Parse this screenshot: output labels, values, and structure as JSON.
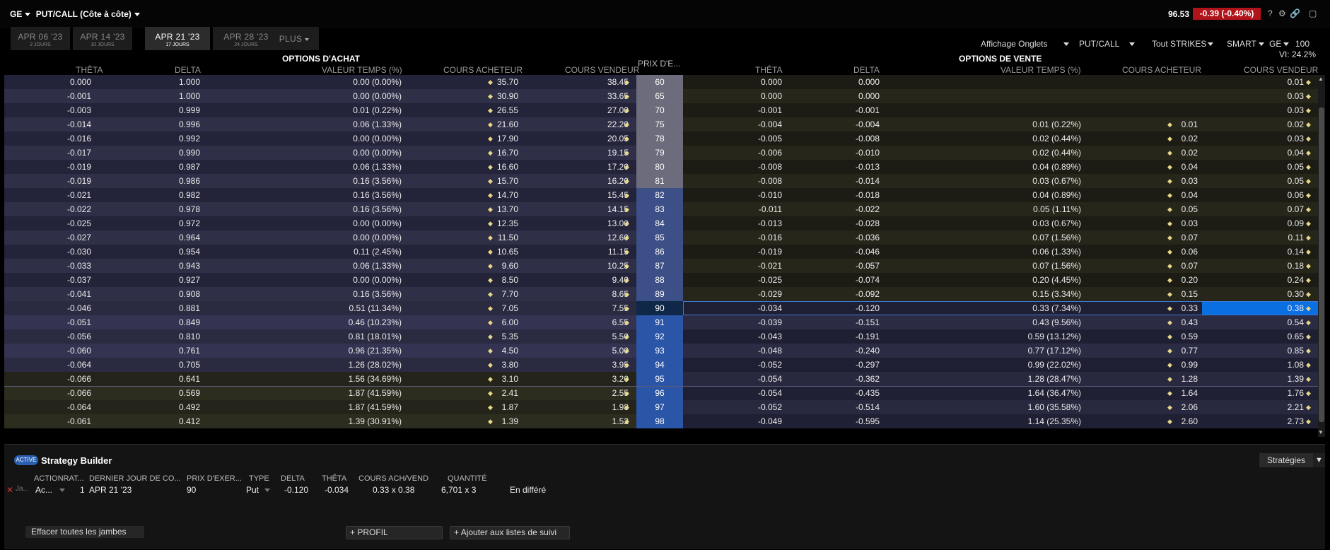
{
  "topbar": {
    "symbol": "GE",
    "view": "PUT/CALL (Côte à côte)",
    "last_price": "96.53",
    "change": "-0.39 (-0.40%)",
    "icons": [
      "help-icon",
      "gear-icon",
      "link-icon",
      "expand-icon"
    ]
  },
  "tabs": [
    {
      "label": "APR 06 '23",
      "sub": "2 JOURS"
    },
    {
      "label": "APR 14 '23",
      "sub": "10 JOURS"
    },
    {
      "label": "APR 21 '23",
      "sub": "17 JOURS"
    },
    {
      "label": "APR 28 '23",
      "sub": "24 JOURS"
    },
    {
      "label": "PLUS",
      "sub": ""
    }
  ],
  "toolbar": {
    "display": "Affichage Onglets",
    "putcall": "PUT/CALL",
    "strikes": "Tout STRIKES",
    "exchange": "SMART",
    "symbol": "GE",
    "multiplier": "100",
    "vi": "VI: 24.2%"
  },
  "headers": {
    "calls_title": "OPTIONS D'ACHAT",
    "puts_title": "OPTIONS DE VENTE",
    "theta": "THÊTA",
    "delta": "DELTA",
    "time_value": "VALEUR TEMPS (%)",
    "bid": "COURS ACHETEUR",
    "ask": "COURS VENDEUR",
    "strike": "PRIX D'E..."
  },
  "rows": [
    {
      "strike": "60",
      "c_theta": "0.000",
      "c_delta": "1.000",
      "c_tv": "0.00 (0.00%)",
      "c_bid": "35.70",
      "c_ask": "38.45",
      "p_theta": "0.000",
      "p_delta": "0.000",
      "p_tv": "",
      "p_bid": "",
      "p_ask": "0.01"
    },
    {
      "strike": "65",
      "c_theta": "-0.001",
      "c_delta": "1.000",
      "c_tv": "0.00 (0.00%)",
      "c_bid": "30.90",
      "c_ask": "33.65",
      "p_theta": "0.000",
      "p_delta": "0.000",
      "p_tv": "",
      "p_bid": "",
      "p_ask": "0.03"
    },
    {
      "strike": "70",
      "c_theta": "-0.003",
      "c_delta": "0.999",
      "c_tv": "0.01 (0.22%)",
      "c_bid": "26.55",
      "c_ask": "27.00",
      "p_theta": "-0.001",
      "p_delta": "-0.001",
      "p_tv": "",
      "p_bid": "",
      "p_ask": "0.03"
    },
    {
      "strike": "75",
      "c_theta": "-0.014",
      "c_delta": "0.996",
      "c_tv": "0.06 (1.33%)",
      "c_bid": "21.60",
      "c_ask": "22.20",
      "p_theta": "-0.004",
      "p_delta": "-0.004",
      "p_tv": "0.01 (0.22%)",
      "p_bid": "0.01",
      "p_ask": "0.02"
    },
    {
      "strike": "78",
      "c_theta": "-0.016",
      "c_delta": "0.992",
      "c_tv": "0.00 (0.00%)",
      "c_bid": "17.90",
      "c_ask": "20.05",
      "p_theta": "-0.005",
      "p_delta": "-0.008",
      "p_tv": "0.02 (0.44%)",
      "p_bid": "0.02",
      "p_ask": "0.03"
    },
    {
      "strike": "79",
      "c_theta": "-0.017",
      "c_delta": "0.990",
      "c_tv": "0.00 (0.00%)",
      "c_bid": "16.70",
      "c_ask": "19.15",
      "p_theta": "-0.006",
      "p_delta": "-0.010",
      "p_tv": "0.02 (0.44%)",
      "p_bid": "0.02",
      "p_ask": "0.04"
    },
    {
      "strike": "80",
      "c_theta": "-0.019",
      "c_delta": "0.987",
      "c_tv": "0.06 (1.33%)",
      "c_bid": "16.60",
      "c_ask": "17.20",
      "p_theta": "-0.008",
      "p_delta": "-0.013",
      "p_tv": "0.04 (0.89%)",
      "p_bid": "0.04",
      "p_ask": "0.05"
    },
    {
      "strike": "81",
      "c_theta": "-0.019",
      "c_delta": "0.986",
      "c_tv": "0.16 (3.56%)",
      "c_bid": "15.70",
      "c_ask": "16.20",
      "p_theta": "-0.008",
      "p_delta": "-0.014",
      "p_tv": "0.03 (0.67%)",
      "p_bid": "0.03",
      "p_ask": "0.05"
    },
    {
      "strike": "82",
      "c_theta": "-0.021",
      "c_delta": "0.982",
      "c_tv": "0.16 (3.56%)",
      "c_bid": "14.70",
      "c_ask": "15.45",
      "p_theta": "-0.010",
      "p_delta": "-0.018",
      "p_tv": "0.04 (0.89%)",
      "p_bid": "0.04",
      "p_ask": "0.06"
    },
    {
      "strike": "83",
      "c_theta": "-0.022",
      "c_delta": "0.978",
      "c_tv": "0.16 (3.56%)",
      "c_bid": "13.70",
      "c_ask": "14.15",
      "p_theta": "-0.011",
      "p_delta": "-0.022",
      "p_tv": "0.05 (1.11%)",
      "p_bid": "0.05",
      "p_ask": "0.07"
    },
    {
      "strike": "84",
      "c_theta": "-0.025",
      "c_delta": "0.972",
      "c_tv": "0.00 (0.00%)",
      "c_bid": "12.35",
      "c_ask": "13.00",
      "p_theta": "-0.013",
      "p_delta": "-0.028",
      "p_tv": "0.03 (0.67%)",
      "p_bid": "0.03",
      "p_ask": "0.09"
    },
    {
      "strike": "85",
      "c_theta": "-0.027",
      "c_delta": "0.964",
      "c_tv": "0.00 (0.00%)",
      "c_bid": "11.50",
      "c_ask": "12.60",
      "p_theta": "-0.016",
      "p_delta": "-0.036",
      "p_tv": "0.07 (1.56%)",
      "p_bid": "0.07",
      "p_ask": "0.11"
    },
    {
      "strike": "86",
      "c_theta": "-0.030",
      "c_delta": "0.954",
      "c_tv": "0.11 (2.45%)",
      "c_bid": "10.65",
      "c_ask": "11.15",
      "p_theta": "-0.019",
      "p_delta": "-0.046",
      "p_tv": "0.06 (1.33%)",
      "p_bid": "0.06",
      "p_ask": "0.14"
    },
    {
      "strike": "87",
      "c_theta": "-0.033",
      "c_delta": "0.943",
      "c_tv": "0.06 (1.33%)",
      "c_bid": "9.60",
      "c_ask": "10.25",
      "p_theta": "-0.021",
      "p_delta": "-0.057",
      "p_tv": "0.07 (1.56%)",
      "p_bid": "0.07",
      "p_ask": "0.18"
    },
    {
      "strike": "88",
      "c_theta": "-0.037",
      "c_delta": "0.927",
      "c_tv": "0.00 (0.00%)",
      "c_bid": "8.50",
      "c_ask": "9.40",
      "p_theta": "-0.025",
      "p_delta": "-0.074",
      "p_tv": "0.20 (4.45%)",
      "p_bid": "0.20",
      "p_ask": "0.24"
    },
    {
      "strike": "89",
      "c_theta": "-0.041",
      "c_delta": "0.908",
      "c_tv": "0.16 (3.56%)",
      "c_bid": "7.70",
      "c_ask": "8.65",
      "p_theta": "-0.029",
      "p_delta": "-0.092",
      "p_tv": "0.15 (3.34%)",
      "p_bid": "0.15",
      "p_ask": "0.30"
    },
    {
      "strike": "90",
      "c_theta": "-0.046",
      "c_delta": "0.881",
      "c_tv": "0.51 (11.34%)",
      "c_bid": "7.05",
      "c_ask": "7.55",
      "p_theta": "-0.034",
      "p_delta": "-0.120",
      "p_tv": "0.33 (7.34%)",
      "p_bid": "0.33",
      "p_ask": "0.38"
    },
    {
      "strike": "91",
      "c_theta": "-0.051",
      "c_delta": "0.849",
      "c_tv": "0.46 (10.23%)",
      "c_bid": "6.00",
      "c_ask": "6.55",
      "p_theta": "-0.039",
      "p_delta": "-0.151",
      "p_tv": "0.43 (9.56%)",
      "p_bid": "0.43",
      "p_ask": "0.54"
    },
    {
      "strike": "92",
      "c_theta": "-0.056",
      "c_delta": "0.810",
      "c_tv": "0.81 (18.01%)",
      "c_bid": "5.35",
      "c_ask": "5.50",
      "p_theta": "-0.043",
      "p_delta": "-0.191",
      "p_tv": "0.59 (13.12%)",
      "p_bid": "0.59",
      "p_ask": "0.65"
    },
    {
      "strike": "93",
      "c_theta": "-0.060",
      "c_delta": "0.761",
      "c_tv": "0.96 (21.35%)",
      "c_bid": "4.50",
      "c_ask": "5.00",
      "p_theta": "-0.048",
      "p_delta": "-0.240",
      "p_tv": "0.77 (17.12%)",
      "p_bid": "0.77",
      "p_ask": "0.85"
    },
    {
      "strike": "94",
      "c_theta": "-0.064",
      "c_delta": "0.705",
      "c_tv": "1.26 (28.02%)",
      "c_bid": "3.80",
      "c_ask": "3.95",
      "p_theta": "-0.052",
      "p_delta": "-0.297",
      "p_tv": "0.99 (22.02%)",
      "p_bid": "0.99",
      "p_ask": "1.08"
    },
    {
      "strike": "95",
      "c_theta": "-0.066",
      "c_delta": "0.641",
      "c_tv": "1.56 (34.69%)",
      "c_bid": "3.10",
      "c_ask": "3.20",
      "p_theta": "-0.054",
      "p_delta": "-0.362",
      "p_tv": "1.28 (28.47%)",
      "p_bid": "1.28",
      "p_ask": "1.39"
    },
    {
      "strike": "96",
      "c_theta": "-0.066",
      "c_delta": "0.569",
      "c_tv": "1.87 (41.59%)",
      "c_bid": "2.41",
      "c_ask": "2.55",
      "p_theta": "-0.054",
      "p_delta": "-0.435",
      "p_tv": "1.64 (36.47%)",
      "p_bid": "1.64",
      "p_ask": "1.76"
    },
    {
      "strike": "97",
      "c_theta": "-0.064",
      "c_delta": "0.492",
      "c_tv": "1.87 (41.59%)",
      "c_bid": "1.87",
      "c_ask": "1.98",
      "p_theta": "-0.052",
      "p_delta": "-0.514",
      "p_tv": "1.60 (35.58%)",
      "p_bid": "2.06",
      "p_ask": "2.21"
    },
    {
      "strike": "98",
      "c_theta": "-0.061",
      "c_delta": "0.412",
      "c_tv": "1.39 (30.91%)",
      "c_bid": "1.39",
      "c_ask": "1.52",
      "p_theta": "-0.049",
      "p_delta": "-0.595",
      "p_tv": "1.14 (25.35%)",
      "p_bid": "2.60",
      "p_ask": "2.73"
    }
  ],
  "selected_strike": "90",
  "strategy_builder": {
    "toggle": "ACTIVE",
    "title": "Strategy Builder",
    "strategies_button": "Stratégies",
    "headers": {
      "action": "ACTIONRAT...",
      "last_day": "DERNIER JOUR DE CO...",
      "strike": "PRIX D'EXER...",
      "type": "TYPE",
      "delta": "DELTA",
      "theta": "THÊTA",
      "bid_ask": "COURS ACH/VEND",
      "qty": "QUANTITÉ"
    },
    "leg": {
      "remove": "Ja...",
      "action": "Ac...",
      "ratio": "1",
      "last_day": "APR 21 '23",
      "strike": "90",
      "type": "Put",
      "delta": "-0.120",
      "theta": "-0.034",
      "bid_ask": "0.33 x 0.38",
      "qty": "6,701 x 3",
      "status": "En différé"
    },
    "clear_button": "Effacer toutes les jambes",
    "profile_button": "PROFIL",
    "watchlist_button": "Ajouter aux listes de suivi"
  }
}
